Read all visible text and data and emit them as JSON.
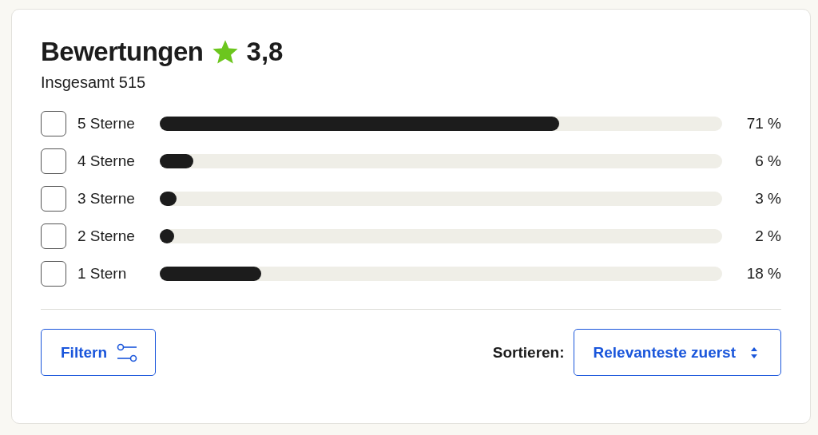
{
  "title": "Bewertungen",
  "rating": "3,8",
  "total": "Insgesamt 515",
  "rows": [
    {
      "label": "5 Sterne",
      "checked": false,
      "level": 0.71,
      "reading": "71 %"
    },
    {
      "label": "4 Sterne",
      "checked": false,
      "level": 0.06,
      "reading": "6 %"
    },
    {
      "label": "3 Sterne",
      "checked": false,
      "level": 0.03,
      "reading": "3 %"
    },
    {
      "label": "2 Sterne",
      "checked": false,
      "level": 0.02,
      "reading": "2 %"
    },
    {
      "label": "1 Stern",
      "checked": false,
      "level": 0.18,
      "reading": "18 %"
    }
  ],
  "filter_button": "Filtern",
  "sort_label": "Sortieren:",
  "sort_value": "Relevanteste zuerst"
}
